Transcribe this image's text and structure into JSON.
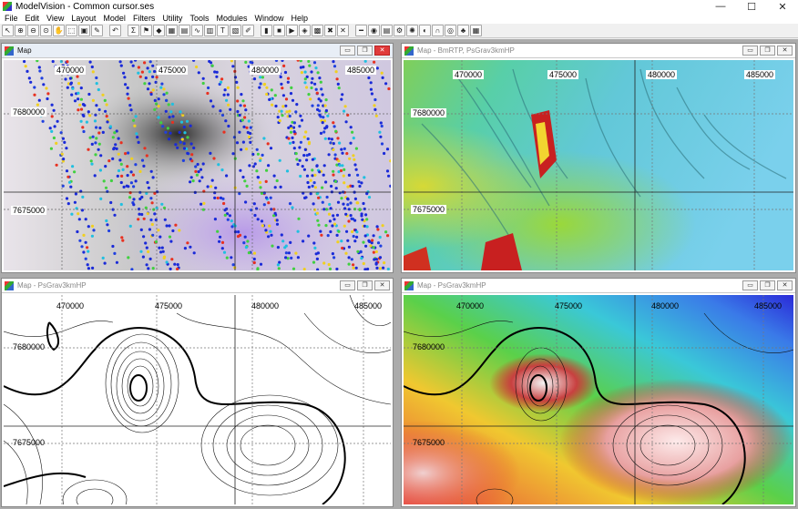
{
  "window": {
    "title": "ModelVision - Common cursor.ses",
    "controls": [
      "—",
      "☐",
      "✕"
    ]
  },
  "menu": [
    "File",
    "Edit",
    "View",
    "Layout",
    "Model",
    "Filters",
    "Utility",
    "Tools",
    "Modules",
    "Window",
    "Help"
  ],
  "toolbar": {
    "group1": [
      {
        "name": "pointer-tool",
        "glyph": "↖"
      },
      {
        "name": "zoom-in-tool",
        "glyph": "⊕"
      },
      {
        "name": "zoom-out-tool",
        "glyph": "⊖"
      },
      {
        "name": "zoom-tool",
        "glyph": "⊙"
      },
      {
        "name": "pan-tool",
        "glyph": "✋"
      },
      {
        "name": "select-region-tool",
        "glyph": "⬚"
      },
      {
        "name": "fit-tool",
        "glyph": "▣"
      },
      {
        "name": "measure-tool",
        "glyph": "✎"
      }
    ],
    "group2": [
      {
        "name": "undo-tool",
        "glyph": "↶"
      }
    ],
    "group3": [
      {
        "name": "sum-tool",
        "glyph": "Σ"
      },
      {
        "name": "flag-tool",
        "glyph": "⚑"
      },
      {
        "name": "body-tool",
        "glyph": "◆"
      },
      {
        "name": "grid-tool",
        "glyph": "▦"
      },
      {
        "name": "line-tool",
        "glyph": "▤"
      },
      {
        "name": "profile-tool",
        "glyph": "∿"
      },
      {
        "name": "table-tool",
        "glyph": "▥"
      },
      {
        "name": "text-tool",
        "glyph": "T"
      },
      {
        "name": "calc-tool",
        "glyph": "▧"
      },
      {
        "name": "paint-tool",
        "glyph": "✐"
      }
    ],
    "group4": [
      {
        "name": "bars-tool",
        "glyph": "▮"
      },
      {
        "name": "stop-tool",
        "glyph": "■"
      },
      {
        "name": "play-tool",
        "glyph": "▶"
      },
      {
        "name": "record-tool",
        "glyph": "◈"
      },
      {
        "name": "checker-tool",
        "glyph": "▩"
      },
      {
        "name": "cross-tool",
        "glyph": "✖"
      },
      {
        "name": "cross-hair-tool",
        "glyph": "✕"
      }
    ],
    "group5": [
      {
        "name": "ruler-tool",
        "glyph": "━"
      },
      {
        "name": "globe-tool",
        "glyph": "◉"
      },
      {
        "name": "database-tool",
        "glyph": "▤"
      },
      {
        "name": "gear-tool",
        "glyph": "⚙"
      },
      {
        "name": "lightbulb-tool",
        "glyph": "✺"
      },
      {
        "name": "section-tool",
        "glyph": "◐"
      },
      {
        "name": "magnet-tool",
        "glyph": "∩"
      },
      {
        "name": "target-tool",
        "glyph": "◎"
      },
      {
        "name": "tree-tool",
        "glyph": "♣"
      },
      {
        "name": "table2-tool",
        "glyph": "▦"
      }
    ]
  },
  "panels": [
    {
      "id": "tl",
      "title": "Map",
      "active": true,
      "grid_labels_x": [
        "470000",
        "475000",
        "480000",
        "485000"
      ],
      "grid_labels_y": [
        "7680000",
        "7675000"
      ]
    },
    {
      "id": "tr",
      "title": "Map - BmRTP, PsGrav3kmHP",
      "active": false,
      "grid_labels_x": [
        "470000",
        "475000",
        "480000",
        "485000"
      ],
      "grid_labels_y": [
        "7680000",
        "7675000"
      ]
    },
    {
      "id": "bl",
      "title": "Map - PsGrav3kmHP",
      "active": false,
      "grid_labels_x": [
        "470000",
        "475000",
        "480000",
        "485000"
      ],
      "grid_labels_y": [
        "7680000",
        "7675000"
      ]
    },
    {
      "id": "br",
      "title": "Map - PsGrav3kmHP",
      "active": false,
      "grid_labels_x": [
        "470000",
        "475000",
        "480000",
        "485000"
      ],
      "grid_labels_y": [
        "7680000",
        "7675000"
      ]
    }
  ],
  "child_controls": [
    "▭",
    "❐",
    "✕"
  ]
}
